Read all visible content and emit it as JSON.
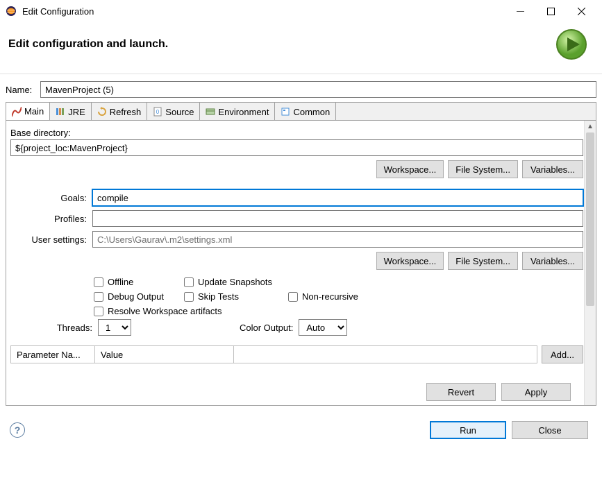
{
  "window": {
    "title": "Edit Configuration"
  },
  "header": {
    "title": "Edit configuration and launch."
  },
  "name": {
    "label": "Name:",
    "value": "MavenProject (5)"
  },
  "tabs": {
    "main": "Main",
    "jre": "JRE",
    "refresh": "Refresh",
    "source": "Source",
    "environment": "Environment",
    "common": "Common"
  },
  "baseDir": {
    "label": "Base directory:",
    "value": "${project_loc:MavenProject}",
    "workspace": "Workspace...",
    "filesystem": "File System...",
    "variables": "Variables..."
  },
  "goals": {
    "label": "Goals:",
    "value": "compile"
  },
  "profiles": {
    "label": "Profiles:",
    "value": ""
  },
  "userSettings": {
    "label": "User settings:",
    "value": "C:\\Users\\Gaurav\\.m2\\settings.xml"
  },
  "settingsButtons": {
    "workspace": "Workspace...",
    "filesystem": "File System...",
    "variables": "Variables..."
  },
  "checks": {
    "offline": "Offline",
    "updateSnapshots": "Update Snapshots",
    "debugOutput": "Debug Output",
    "skipTests": "Skip Tests",
    "nonRecursive": "Non-recursive",
    "resolveWorkspace": "Resolve Workspace artifacts"
  },
  "threads": {
    "label": "Threads:",
    "value": "1"
  },
  "colorOutput": {
    "label": "Color Output:",
    "value": "Auto"
  },
  "params": {
    "nameHeader": "Parameter Na...",
    "valueHeader": "Value",
    "add": "Add..."
  },
  "actions": {
    "revert": "Revert",
    "apply": "Apply",
    "run": "Run",
    "close": "Close"
  }
}
